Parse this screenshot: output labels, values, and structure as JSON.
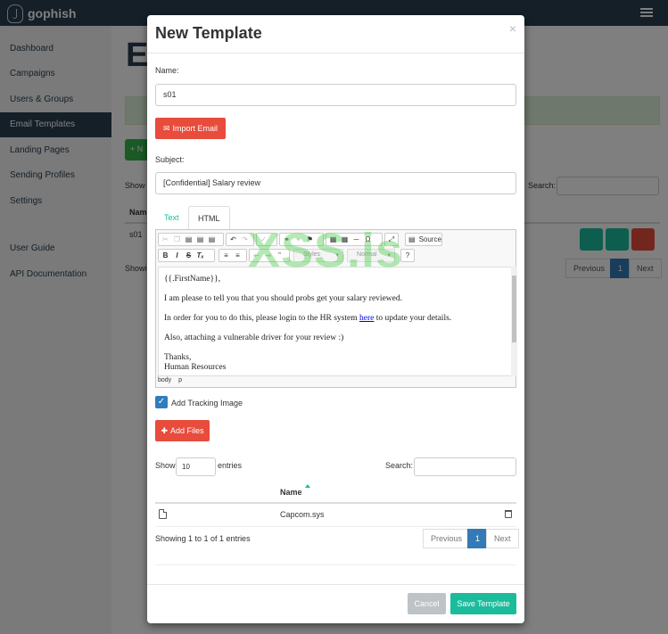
{
  "app": {
    "brand": "gophish"
  },
  "sidebar": {
    "items": [
      {
        "label": "Dashboard"
      },
      {
        "label": "Campaigns"
      },
      {
        "label": "Users & Groups"
      },
      {
        "label": "Email Templates",
        "active": true
      },
      {
        "label": "Landing Pages"
      },
      {
        "label": "Sending Profiles"
      },
      {
        "label": "Settings"
      },
      {
        "label": "User Guide"
      },
      {
        "label": "API Documentation"
      }
    ]
  },
  "background": {
    "title_partial": "E",
    "new_button_partial": "+ N",
    "show_label": "Show",
    "search_label": "Search:",
    "table_header_partial": "Nam",
    "row_name": "s01",
    "showing_partial": "Showi",
    "pagination": {
      "previous": "Previous",
      "page": "1",
      "next": "Next"
    }
  },
  "modal": {
    "title": "New Template",
    "close": "×",
    "name_label": "Name:",
    "name_value": "s01",
    "import_button": "Import Email",
    "subject_label": "Subject:",
    "subject_value": "[Confidential] Salary review",
    "tabs": {
      "text": "Text",
      "html": "HTML"
    },
    "editor": {
      "source_label": "Source",
      "styles_placeholder": "Styles",
      "format_placeholder": "Normal",
      "content": {
        "line1": "{{.FirstName}},",
        "line2": "I am please to tell you that you should probs get your salary reviewed.",
        "line3_before": "In order for you to do this, please login to the HR system ",
        "line3_link": "here",
        "line3_after": " to update your details.",
        "line4": "Also, attaching a vulnerable driver for your review :)",
        "line5": "Thanks,",
        "line6": "Human Resources"
      },
      "path": [
        "body",
        "p"
      ]
    },
    "tracking_label": "Add Tracking Image",
    "tracking_checked": true,
    "add_files_button": "Add Files",
    "files_table": {
      "show_label": "Show",
      "entries_value": "10",
      "entries_label": "entries",
      "search_label": "Search:",
      "header_name": "Name",
      "rows": [
        {
          "name": "Capcom.sys"
        }
      ],
      "info": "Showing 1 to 1 of 1 entries",
      "pagination": {
        "previous": "Previous",
        "page": "1",
        "next": "Next"
      }
    },
    "cancel_button": "Cancel",
    "save_button": "Save Template"
  },
  "watermark": "XSS.is",
  "colors": {
    "navbar": "#283f50",
    "accent": "#1abc9c",
    "danger": "#e74c3c",
    "primary": "#337ab7",
    "muted_button": "#bdc3c7"
  }
}
